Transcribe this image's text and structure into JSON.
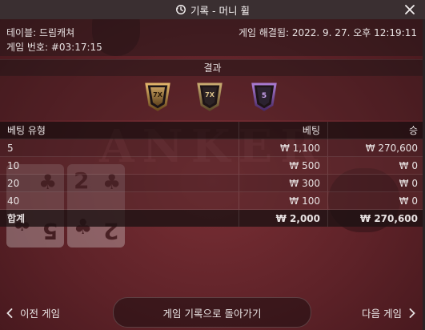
{
  "titlebar": {
    "title": "기록 - 머니 휠",
    "icon": "history-clock-icon",
    "close_icon": "close-icon"
  },
  "info": {
    "table_label": "테이블: 드림캐쳐",
    "game_number_label": "게임 번호: #03:17:15",
    "resolved_label": "게임 해결됨: 2022. 9. 27. 오후 12:19:11"
  },
  "result": {
    "header": "결과",
    "chips": [
      {
        "label": "7X",
        "color": "#b78a44"
      },
      {
        "label": "7X",
        "color": "#8a7650"
      },
      {
        "label": "5",
        "color": "#7a4aa0"
      }
    ]
  },
  "bets_table": {
    "columns": [
      "베팅 유형",
      "베팅",
      "승"
    ],
    "rows": [
      {
        "type": "5",
        "bet": "₩ 1,100",
        "win": "₩ 270,600"
      },
      {
        "type": "10",
        "bet": "₩ 500",
        "win": "₩ 0"
      },
      {
        "type": "20",
        "bet": "₩ 300",
        "win": "₩ 0"
      },
      {
        "type": "40",
        "bet": "₩ 100",
        "win": "₩ 0"
      }
    ],
    "total": {
      "label": "합계",
      "bet": "₩ 2,000",
      "win": "₩ 270,600"
    }
  },
  "background": {
    "watermark": "ANKER",
    "card_ranks": [
      "2",
      "5",
      "2"
    ]
  },
  "nav": {
    "prev_label": "이전 게임",
    "back_label": "게임 기록으로 돌아가기",
    "next_label": "다음 게임"
  }
}
